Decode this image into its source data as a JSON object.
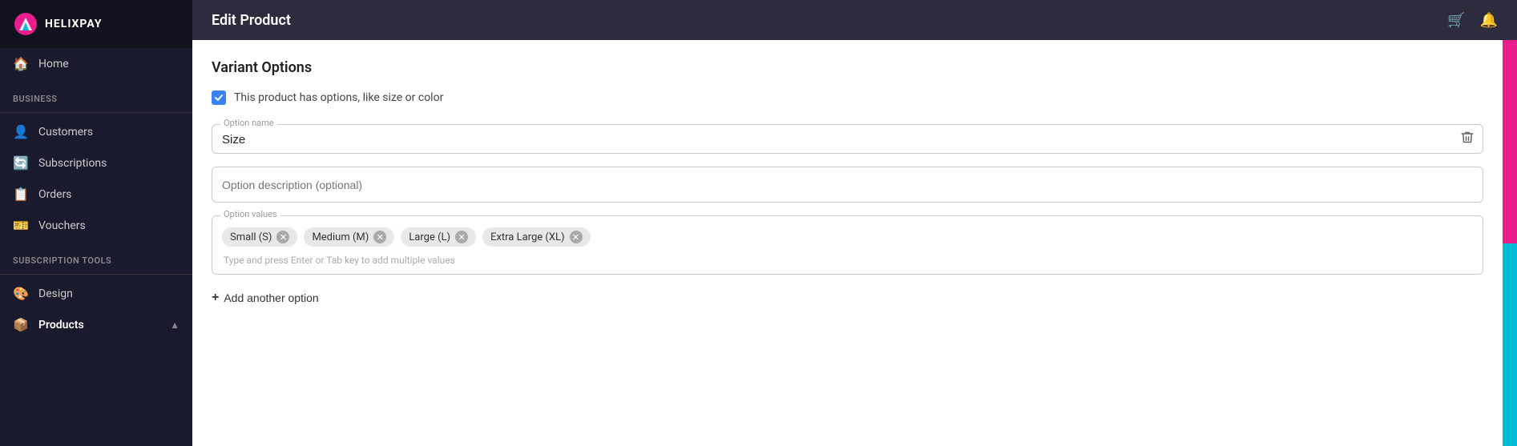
{
  "sidebar": {
    "logo_text": "HELIXPAY",
    "home_label": "Home",
    "business_label": "Business",
    "items": [
      {
        "id": "customers",
        "label": "Customers",
        "icon": "👤"
      },
      {
        "id": "subscriptions",
        "label": "Subscriptions",
        "icon": "🔄"
      },
      {
        "id": "orders",
        "label": "Orders",
        "icon": "📋"
      },
      {
        "id": "vouchers",
        "label": "Vouchers",
        "icon": "🎫"
      }
    ],
    "subscription_tools_label": "Subscription Tools",
    "tools_items": [
      {
        "id": "design",
        "label": "Design",
        "icon": "🎨"
      },
      {
        "id": "products",
        "label": "Products",
        "icon": "📦",
        "has_chevron": true,
        "chevron": "▲"
      }
    ]
  },
  "topbar": {
    "title": "Edit Product",
    "cart_icon": "🛒",
    "bell_icon": "🔔"
  },
  "variant": {
    "section_title": "Variant Options",
    "checkbox_label": "This product has options, like size or color",
    "option_name_legend": "Option name",
    "option_name_value": "Size",
    "option_desc_placeholder": "Option description (optional)",
    "option_values_legend": "Option values",
    "values_hint": "Type and press Enter or Tab key to add multiple values",
    "chips": [
      {
        "id": "small",
        "label": "Small (S)"
      },
      {
        "id": "medium",
        "label": "Medium (M)"
      },
      {
        "id": "large",
        "label": "Large (L)"
      },
      {
        "id": "xl",
        "label": "Extra Large (XL)"
      }
    ],
    "add_option_label": "Add another option",
    "delete_icon": "🗑"
  }
}
